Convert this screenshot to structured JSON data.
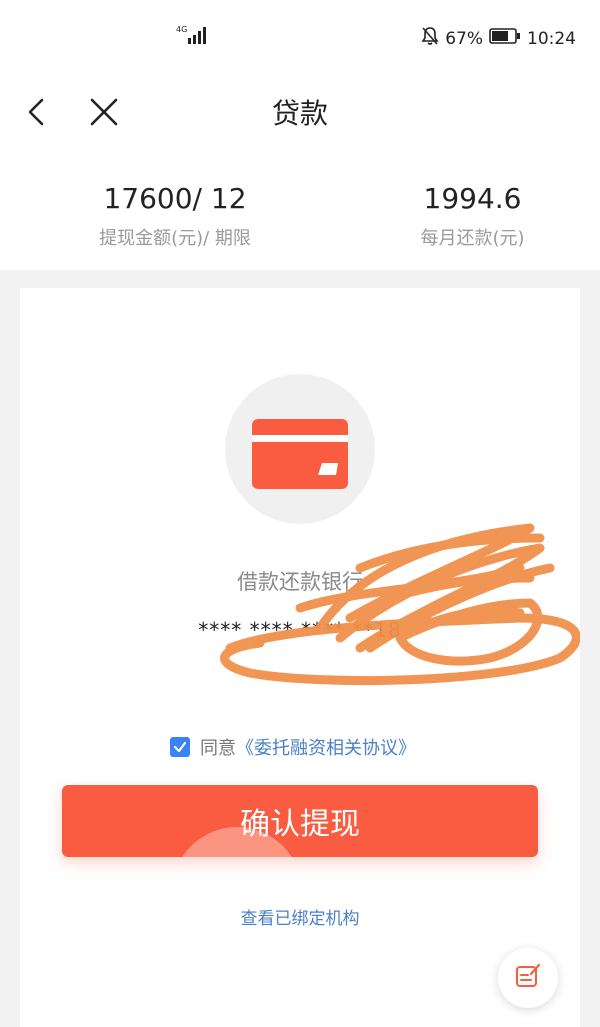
{
  "status_bar": {
    "network": "4G",
    "battery_percent": "67%",
    "time": "10:24"
  },
  "nav": {
    "title": "贷款"
  },
  "summary": {
    "amount_term_value": "17600/ 12",
    "amount_term_label": "提现金额(元)/ 期限",
    "monthly_value": "1994.6",
    "monthly_label": "每月还款(元)"
  },
  "bank": {
    "label": "借款还款银行",
    "card_number": "****  ****  ****  **18"
  },
  "agreement": {
    "prefix": "同意",
    "link": "《委托融资相关协议》",
    "checked": true
  },
  "confirm_label": "确认提现",
  "bound_link": "查看已绑定机构",
  "colors": {
    "accent": "#f95c40",
    "link": "#4a7fc9",
    "checkbox": "#3b82f6",
    "scribble": "#f0904a"
  }
}
